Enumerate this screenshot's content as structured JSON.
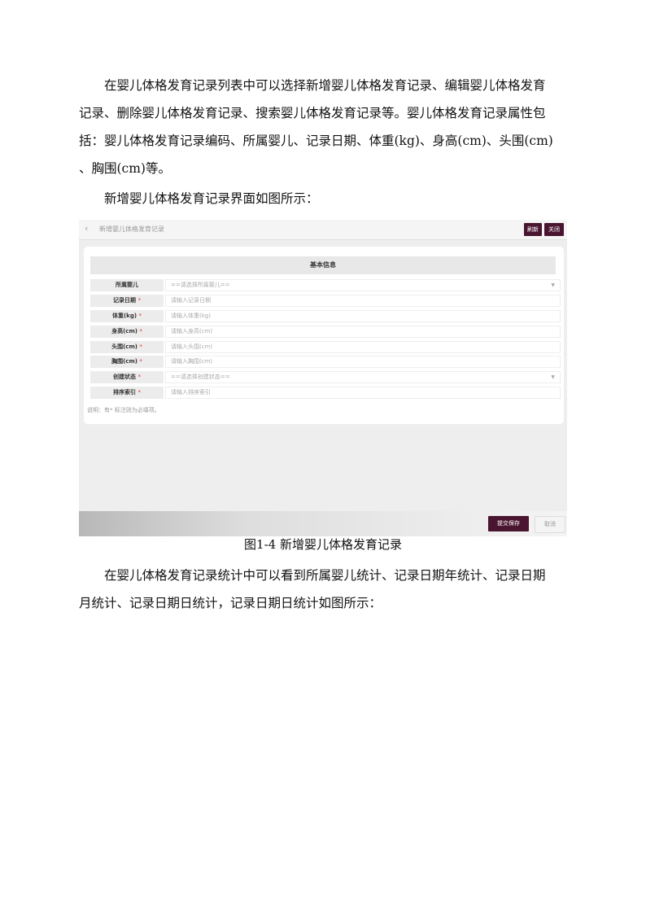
{
  "paragraphs": {
    "p1": [
      "在婴儿体格发育记录列表中可以选择新增婴儿体格发育记录、编辑婴儿体格发育",
      "记录、删除婴儿体格发育记录、搜索婴儿体格发育记录等。婴儿体格发育记录属性包",
      "括：婴儿体格发育记录编码、所属婴儿、记录日期、体重(kg)、身高(cm)、头围(cm)",
      "、胸围(cm)等。"
    ],
    "p2": "新增婴儿体格发育记录界面如图所示：",
    "p3": [
      "在婴儿体格发育记录统计中可以看到所属婴儿统计、记录日期年统计、记录日期",
      "月统计、记录日期日统计，记录日期日统计如图所示："
    ]
  },
  "screenshot": {
    "back_icon": "chevron-left-icon",
    "page_title": "新增婴儿体格发育记录",
    "refresh_label": "刷新",
    "close_label": "关闭",
    "section_title": "基本信息",
    "fields": [
      {
        "label": "所属婴儿",
        "required": "",
        "placeholder": "==请选择所属婴儿==",
        "type": "select"
      },
      {
        "label": "记录日期",
        "required": "*",
        "placeholder": "请输入记录日期",
        "type": "input"
      },
      {
        "label": "体重(kg)",
        "required": "*",
        "placeholder": "请输入体重(kg)",
        "type": "input"
      },
      {
        "label": "身高(cm)",
        "required": "*",
        "placeholder": "请输入身高(cm)",
        "type": "input"
      },
      {
        "label": "头围(cm)",
        "required": "*",
        "placeholder": "请输入头围(cm)",
        "type": "input"
      },
      {
        "label": "胸围(cm)",
        "required": "*",
        "placeholder": "请输入胸围(cm)",
        "type": "input"
      },
      {
        "label": "创建状态",
        "required": "*",
        "placeholder": "==请选择创建状态==",
        "type": "select"
      },
      {
        "label": "排序索引",
        "required": "*",
        "placeholder": "请输入排序索引",
        "type": "input"
      }
    ],
    "note": "说明：有* 标注则为必填项。",
    "submit_label": "提交保存",
    "cancel_label": "取消",
    "accent_color": "#4a1530"
  },
  "caption": "图1-4 新增婴儿体格发育记录"
}
